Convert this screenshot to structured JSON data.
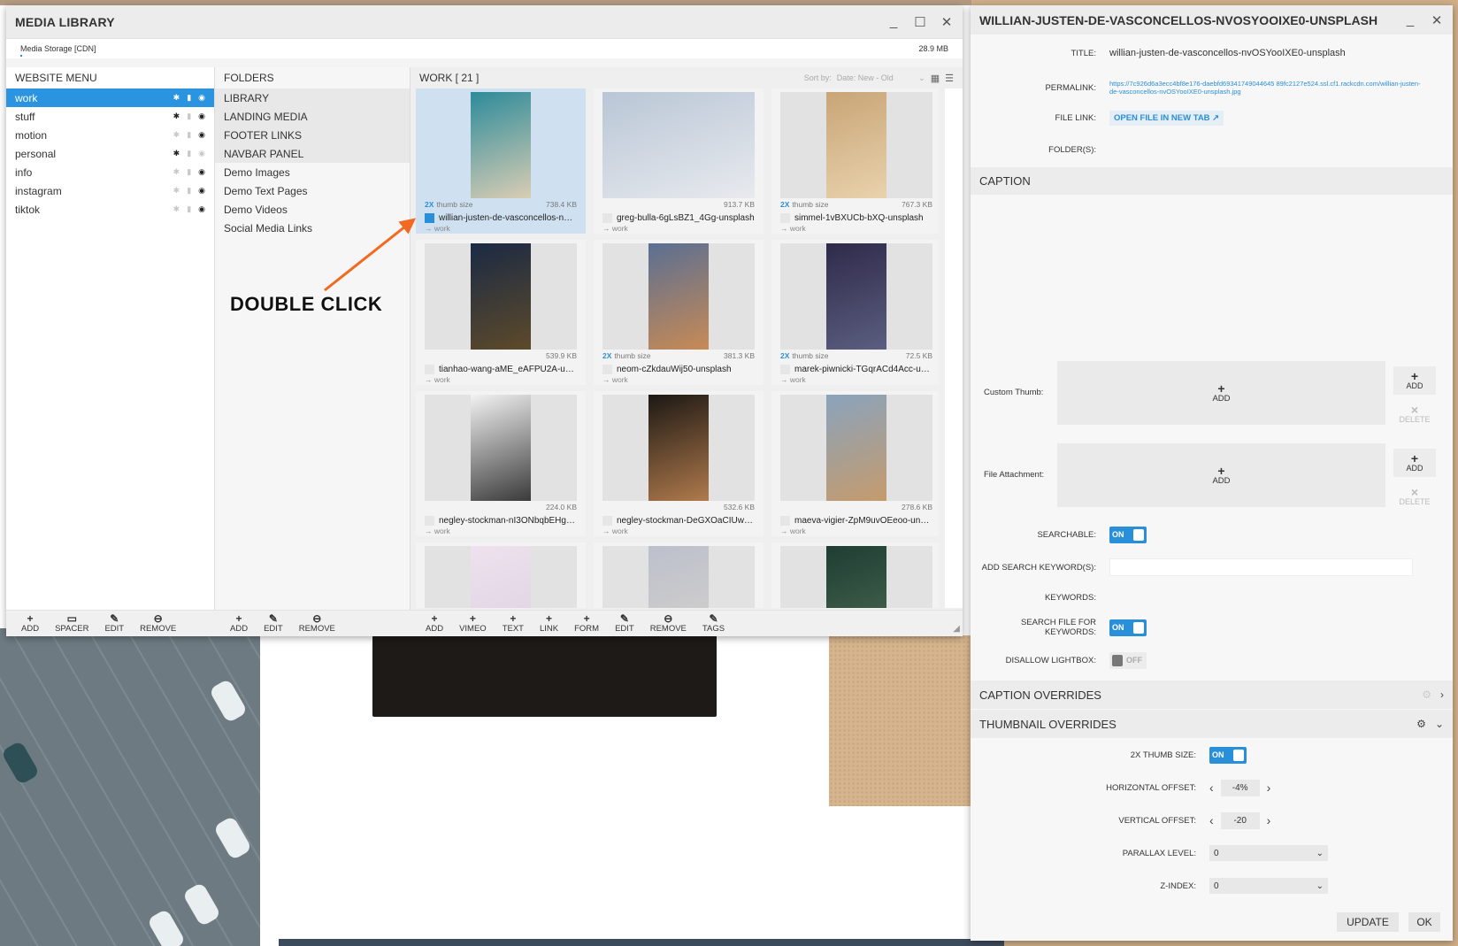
{
  "media_library": {
    "title": "MEDIA LIBRARY",
    "storage_label": "Media Storage [CDN]",
    "storage_size": "28.9 MB",
    "website_menu": {
      "header": "WEBSITE MENU",
      "items": [
        {
          "label": "work",
          "active": true,
          "gear": true,
          "lock_faint": true,
          "eye": true
        },
        {
          "label": "stuff",
          "active": false,
          "gear": true,
          "lock_faint": true,
          "eye": true
        },
        {
          "label": "motion",
          "active": false,
          "gear": false,
          "lock_faint": true,
          "eye": true
        },
        {
          "label": "personal",
          "active": false,
          "gear": true,
          "lock_faint": true,
          "eye": false
        },
        {
          "label": "info",
          "active": false,
          "gear": false,
          "lock_faint": true,
          "eye": true
        },
        {
          "label": "instagram",
          "active": false,
          "gear": false,
          "lock_faint": true,
          "eye": true
        },
        {
          "label": "tiktok",
          "active": false,
          "gear": false,
          "lock_faint": true,
          "eye": true
        }
      ]
    },
    "folders": {
      "header": "FOLDERS",
      "items": [
        {
          "label": "LIBRARY",
          "shaded": true
        },
        {
          "label": "LANDING MEDIA",
          "shaded": true
        },
        {
          "label": "FOOTER LINKS",
          "shaded": true
        },
        {
          "label": "NAVBAR PANEL",
          "shaded": true
        },
        {
          "label": "Demo Images",
          "shaded": false
        },
        {
          "label": "Demo Text Pages",
          "shaded": false
        },
        {
          "label": "Demo Videos",
          "shaded": false
        },
        {
          "label": "Social Media Links",
          "shaded": false
        }
      ]
    },
    "work": {
      "header": "WORK  [ 21 ]",
      "sort_label": "Sort by:",
      "sort_value": "Date: New - Old",
      "tiles": [
        {
          "name": "willian-justen-de-vasconcellos-nvO...",
          "size": "738.4 KB",
          "twox": true,
          "folder": "→ work",
          "selected": true,
          "colors": [
            "#2d8b9a",
            "#d9cdb4"
          ]
        },
        {
          "name": "greg-bulla-6gLsBZ1_4Gg-unsplash",
          "size": "913.7 KB",
          "twox": false,
          "folder": "→ work",
          "selected": false,
          "colors": [
            "#b9c6d6",
            "#e8eaee"
          ]
        },
        {
          "name": "simmel-1vBXUCb-bXQ-unsplash",
          "size": "767.3 KB",
          "twox": true,
          "folder": "→ work",
          "selected": false,
          "colors": [
            "#c8a576",
            "#e9d2ad"
          ]
        },
        {
          "name": "tianhao-wang-aME_eAFPU2A-uns...",
          "size": "539.9 KB",
          "twox": false,
          "folder": "→ work",
          "selected": false,
          "colors": [
            "#1b2a44",
            "#5d4a2a"
          ]
        },
        {
          "name": "neom-cZkdauWij50-unsplash",
          "size": "381.3 KB",
          "twox": true,
          "folder": "→ work",
          "selected": false,
          "colors": [
            "#5a6f93",
            "#c88a55"
          ]
        },
        {
          "name": "marek-piwnicki-TGqrACd4Acc-uns...",
          "size": "72.5 KB",
          "twox": true,
          "folder": "→ work",
          "selected": false,
          "colors": [
            "#2f2a4a",
            "#5b5e80"
          ]
        },
        {
          "name": "negley-stockman-nI3ONbqbEHg-u...",
          "size": "224.0 KB",
          "twox": false,
          "folder": "→ work",
          "selected": false,
          "colors": [
            "#f2f2f2",
            "#3a3a3a"
          ]
        },
        {
          "name": "negley-stockman-DeGXOaCIUwc-...",
          "size": "532.6 KB",
          "twox": false,
          "folder": "→ work",
          "selected": false,
          "colors": [
            "#1c1814",
            "#b07a4c"
          ]
        },
        {
          "name": "maeva-vigier-ZpM9uvOEeoo-unsp...",
          "size": "278.6 KB",
          "twox": false,
          "folder": "→ work",
          "selected": false,
          "colors": [
            "#8aa3bd",
            "#c59b6d"
          ]
        },
        {
          "name": "",
          "size": "",
          "twox": false,
          "folder": "",
          "selected": false,
          "colors": [
            "#efe2ee",
            "#dccfe0"
          ]
        },
        {
          "name": "",
          "size": "",
          "twox": false,
          "folder": "",
          "selected": false,
          "colors": [
            "#bcc0cc",
            "#d6d2cc"
          ]
        },
        {
          "name": "",
          "size": "",
          "twox": false,
          "folder": "",
          "selected": false,
          "colors": [
            "#1f3d33",
            "#4c6b52"
          ]
        }
      ],
      "twox_label": "2X",
      "thumb_size_label": "thumb size"
    },
    "footer": {
      "menu_buttons": [
        {
          "icon": "+",
          "label": "ADD",
          "name": "add"
        },
        {
          "icon": "▭",
          "label": "SPACER",
          "name": "spacer"
        },
        {
          "icon": "✎",
          "label": "EDIT",
          "name": "edit"
        },
        {
          "icon": "⊖",
          "label": "REMOVE",
          "name": "remove"
        }
      ],
      "folder_buttons": [
        {
          "icon": "+",
          "label": "ADD",
          "name": "add"
        },
        {
          "icon": "✎",
          "label": "EDIT",
          "name": "edit"
        },
        {
          "icon": "⊖",
          "label": "REMOVE",
          "name": "remove"
        }
      ],
      "work_buttons": [
        {
          "icon": "+",
          "label": "ADD",
          "name": "add"
        },
        {
          "icon": "+",
          "label": "VIMEO",
          "name": "vimeo"
        },
        {
          "icon": "+",
          "label": "TEXT",
          "name": "text"
        },
        {
          "icon": "+",
          "label": "LINK",
          "name": "link"
        },
        {
          "icon": "+",
          "label": "FORM",
          "name": "form"
        },
        {
          "icon": "✎",
          "label": "EDIT",
          "name": "edit"
        },
        {
          "icon": "⊖",
          "label": "REMOVE",
          "name": "remove"
        },
        {
          "icon": "✎",
          "label": "TAGS",
          "name": "tags"
        }
      ]
    }
  },
  "annotation": {
    "double_click": "DOUBLE CLICK",
    "arrow_color": "#f26a21"
  },
  "details": {
    "title": "WILLIAN-JUSTEN-DE-VASCONCELLOS-NVOSYOOIXE0-UNSPLASH",
    "title_label": "TITLE:",
    "title_value": "willian-justen-de-vasconcellos-nvOSYooIXE0-unsplash",
    "permalink_label": "PERMALINK:",
    "permalink_value": "https://7c926d6a3ecc4bf8e176-daebfd69341749044645 89fc2127e524.ssl.cf1.rackcdn.com/willian-justen-de-vasconcellos-nvOSYooIXE0-unsplash.jpg",
    "filelink_label": "FILE LINK:",
    "filelink_value": "OPEN FILE IN NEW TAB ↗",
    "folders_label": "FOLDER(S):",
    "caption_header": "CAPTION",
    "custom_thumb_label": "Custom Thumb:",
    "file_attachment_label": "File Attachment:",
    "add_label": "ADD",
    "delete_label": "DELETE",
    "searchable_label": "SEARCHABLE:",
    "add_keywords_label": "ADD SEARCH KEYWORD(S):",
    "keywords_label": "KEYWORDS:",
    "search_file_label": "SEARCH FILE FOR KEYWORDS:",
    "disallow_lightbox_label": "DISALLOW LIGHTBOX:",
    "on_label": "ON",
    "off_label": "OFF",
    "caption_overrides": "CAPTION OVERRIDES",
    "thumbnail_overrides": "THUMBNAIL OVERRIDES",
    "twox_thumb_label": "2X THUMB SIZE:",
    "h_offset_label": "HORIZONTAL OFFSET:",
    "h_offset_value": "-4%",
    "v_offset_label": "VERTICAL OFFSET:",
    "v_offset_value": "-20",
    "parallax_label": "PARALLAX LEVEL:",
    "parallax_value": "0",
    "zindex_label": "Z-INDEX:",
    "zindex_value": "0",
    "update_button": "UPDATE",
    "ok_button": "OK",
    "accent_color": "#2a8fd9"
  }
}
